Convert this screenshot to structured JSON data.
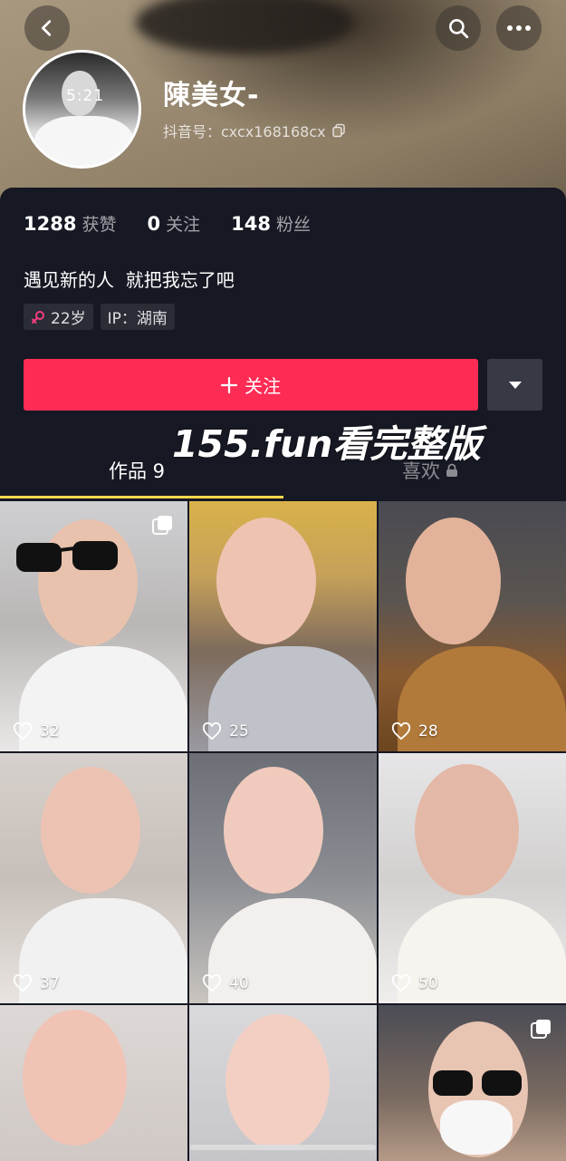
{
  "header": {
    "avatar_time": "5:21",
    "username": "陳美女-",
    "douyin_id": "抖音号：cxcx168168cx"
  },
  "stats": [
    {
      "num": "1288",
      "label": "获赞"
    },
    {
      "num": "0",
      "label": "关注"
    },
    {
      "num": "148",
      "label": "粉丝"
    }
  ],
  "bio": "遇见新的人  就把我忘了吧",
  "tags": {
    "age": "22岁",
    "ip": "IP：湖南"
  },
  "follow_label": "关注",
  "watermark": "155.fun看完整版",
  "tabs": {
    "works": "作品 9",
    "likes": "喜欢"
  },
  "colors": {
    "accent": "#fe2c55",
    "tab_indicator": "#fcd94b",
    "background": "#161823"
  },
  "videos": [
    {
      "likes": "32",
      "multi": true
    },
    {
      "likes": "25",
      "multi": false
    },
    {
      "likes": "28",
      "multi": false
    },
    {
      "likes": "37",
      "multi": false
    },
    {
      "likes": "40",
      "multi": false
    },
    {
      "likes": "50",
      "multi": false
    },
    {
      "likes": "",
      "multi": false
    },
    {
      "likes": "",
      "multi": false
    },
    {
      "likes": "",
      "multi": true
    }
  ]
}
